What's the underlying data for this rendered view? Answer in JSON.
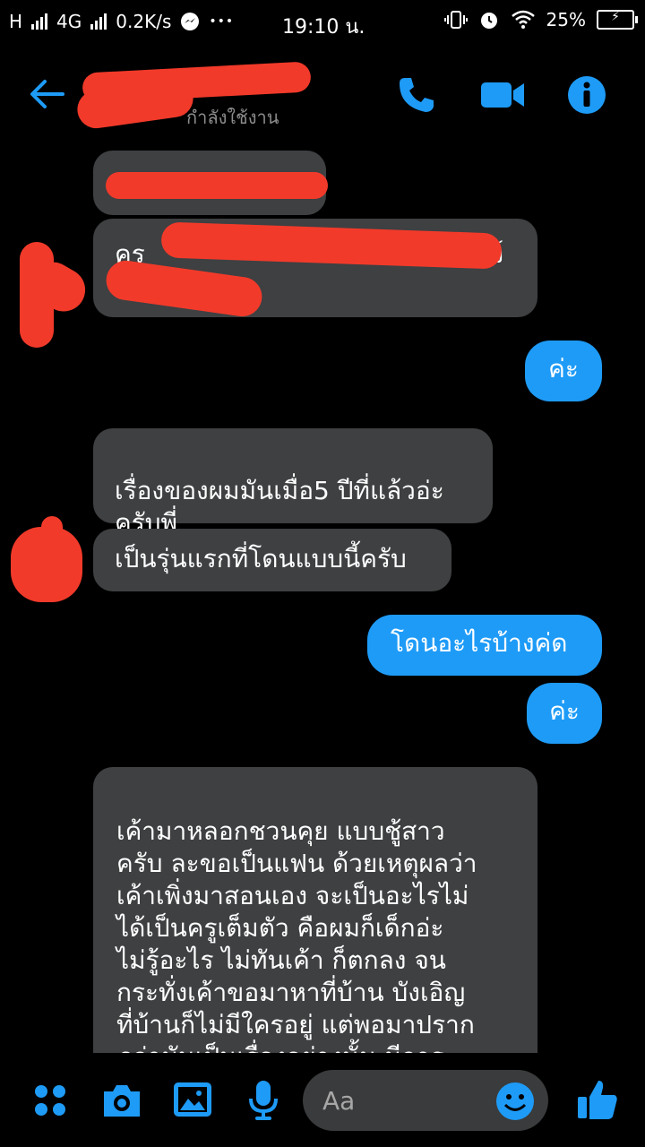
{
  "status_bar": {
    "carrier_h": "H",
    "network": "4G",
    "speed": "0.2K/s",
    "dots": "•••",
    "time": "19:10 น.",
    "battery": "25%"
  },
  "header": {
    "status_text": "กำลังใช้งาน",
    "accent": "#1e9bf7"
  },
  "messages": [
    {
      "side": "in",
      "text": "",
      "redacted": true
    },
    {
      "side": "in",
      "text": "ครู",
      "redacted": true,
      "trailing": "ง์"
    },
    {
      "side": "out",
      "text": "ค่ะ"
    },
    {
      "side": "in",
      "text": "เรื่องของผมมันเมื่อ5 ปีที่แล้วอ่ะ\nครับพี่"
    },
    {
      "side": "in",
      "text": "เป็นรุ่นแรกที่โดนแบบนี้ครับ"
    },
    {
      "side": "out",
      "text": "โดนอะไรบ้างค่ด"
    },
    {
      "side": "out",
      "text": "ค่ะ"
    },
    {
      "side": "in",
      "text": "เค้ามาหลอกชวนคุย แบบชู้สาว\nครับ ละขอเป็นแฟน ด้วยเหตุผลว่า\nเค้าเพิ่งมาสอนเอง จะเป็นอะไรไม่\nได้เป็นครูเต็มตัว คือผมก็เด็กอ่ะ\nไม่รู้อะไร ไม่ทันเค้า ก็ตกลง จน\nกระทั่งเค้าขอมาหาที่บ้าน บังเอิญ\nที่บ้านก็ไม่มีใครอยู่ แต่พอมาปราก\nฎว่ามันเป็นเรื่องอย่างนั้น มีการ"
    }
  ],
  "composer": {
    "placeholder": "Aa",
    "icons": [
      "menu-dots-icon",
      "camera-icon",
      "image-icon",
      "mic-icon",
      "emoji-icon",
      "thumbs-up-icon"
    ]
  }
}
